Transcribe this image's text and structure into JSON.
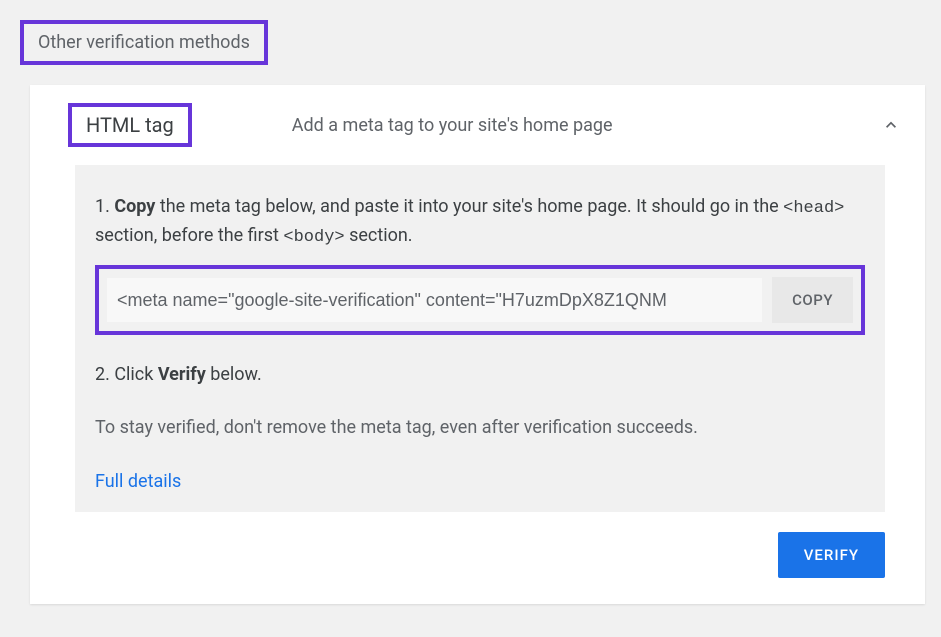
{
  "section": {
    "title": "Other verification methods"
  },
  "method": {
    "name": "HTML tag",
    "description": "Add a meta tag to your site's home page"
  },
  "instructions": {
    "step1_prefix": "1. ",
    "step1_bold": "Copy",
    "step1_text": " the meta tag below, and paste it into your site's home page. It should go in the ",
    "step1_code1": "<head>",
    "step1_mid": " section, before the first ",
    "step1_code2": "<body>",
    "step1_suffix": " section.",
    "meta_tag_value": "<meta name=\"google-site-verification\" content=\"H7uzmDpX8Z1QNM",
    "copy_label": "COPY",
    "step2_prefix": "2. Click ",
    "step2_bold": "Verify",
    "step2_suffix": " below.",
    "note": "To stay verified, don't remove the meta tag, even after verification succeeds.",
    "details_link": "Full details"
  },
  "actions": {
    "verify_label": "VERIFY"
  }
}
